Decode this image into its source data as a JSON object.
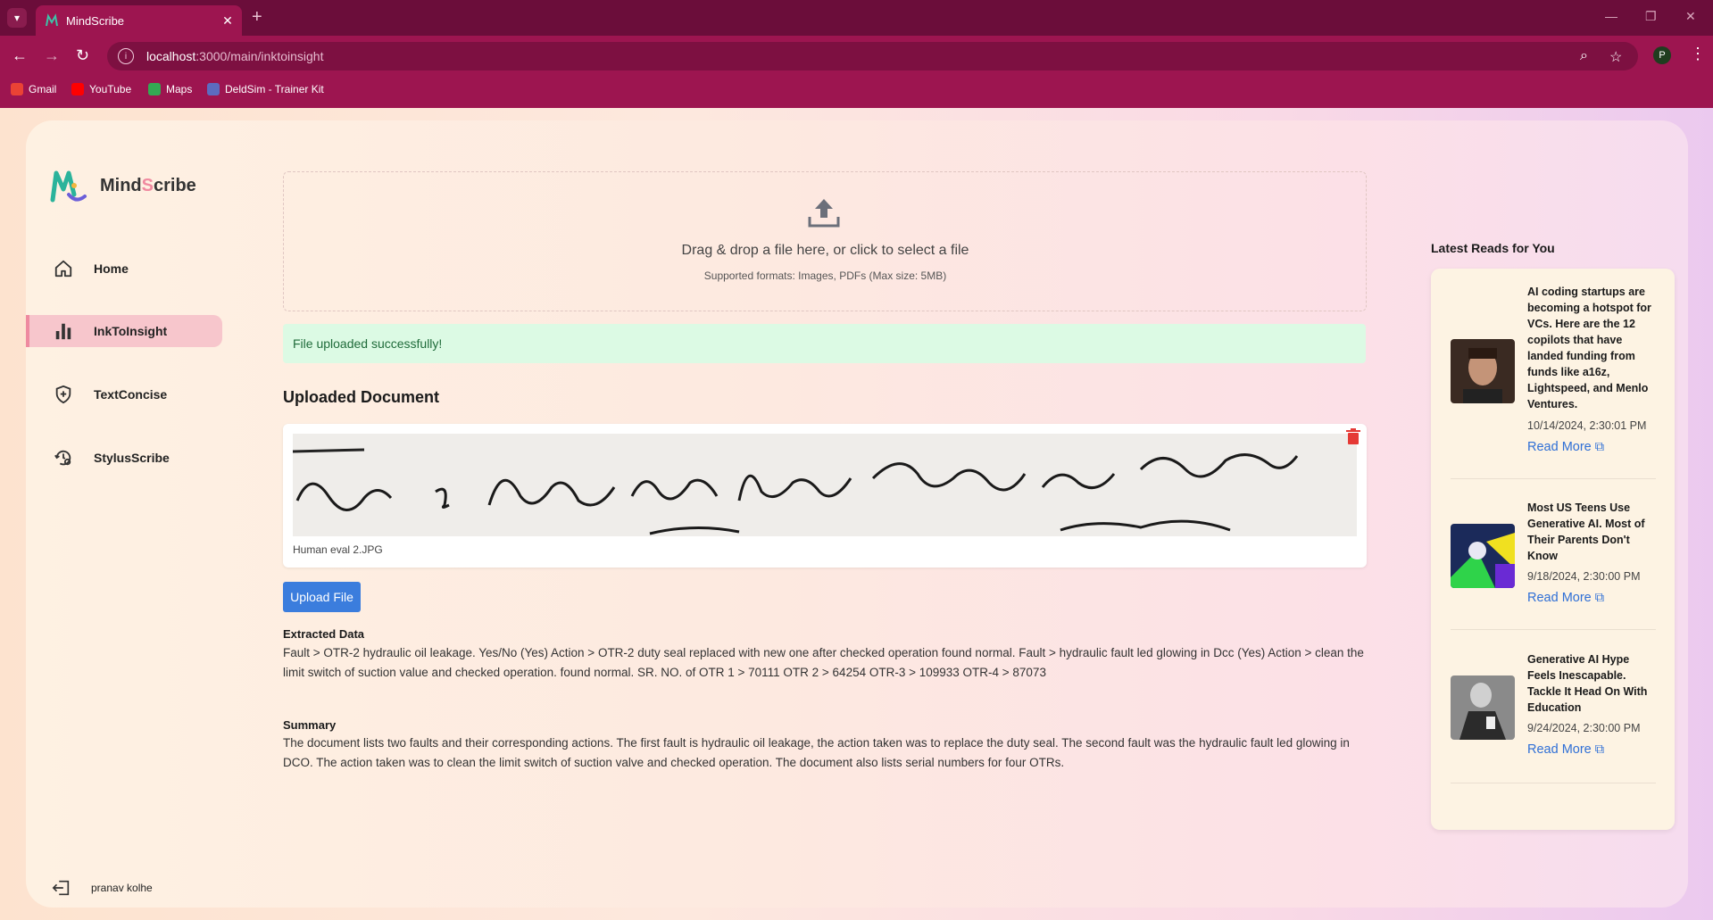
{
  "browser": {
    "tab_title": "MindScribe",
    "url_host": "localhost",
    "url_path": ":3000/main/inktoinsight",
    "profile_initial": "P",
    "bookmarks": [
      {
        "label": "Gmail",
        "color": "#ea4335"
      },
      {
        "label": "YouTube",
        "color": "#ff0000"
      },
      {
        "label": "Maps",
        "color": "#34a853"
      },
      {
        "label": "DeldSim - Trainer Kit",
        "color": "#5c6bc0"
      }
    ]
  },
  "brand": {
    "prefix": "Mind",
    "accent": "S",
    "suffix": "cribe"
  },
  "sidebar": {
    "items": [
      {
        "label": "Home",
        "icon": "home-icon"
      },
      {
        "label": "InkToInsight",
        "icon": "bar-chart-icon",
        "active": true
      },
      {
        "label": "TextConcise",
        "icon": "shield-plus-icon"
      },
      {
        "label": "StylusScribe",
        "icon": "settings-history-icon"
      }
    ],
    "user": "pranav kolhe"
  },
  "upload": {
    "drop_text": "Drag & drop a file here, or click to select a file",
    "supported": "Supported formats: Images, PDFs (Max size: 5MB)",
    "success_message": "File uploaded successfully!",
    "uploaded_heading": "Uploaded Document",
    "file_name": "Human eval 2.JPG",
    "button_label": "Upload File"
  },
  "extracted": {
    "heading": "Extracted Data",
    "text": "Fault > OTR-2 hydraulic oil leakage. Yes/No (Yes) Action > OTR-2 duty seal replaced with new one after checked operation found normal. Fault > hydraulic fault led glowing in Dcc (Yes) Action > clean the limit switch of suction value and checked operation. found normal. SR. NO. of OTR 1 > 70111 OTR 2 > 64254 OTR-3 > 109933 OTR-4 > 87073"
  },
  "summary": {
    "heading": "Summary",
    "text": "The document lists two faults and their corresponding actions. The first fault is hydraulic oil leakage, the action taken was to replace the duty seal. The second fault was the hydraulic fault led glowing in DCO. The action taken was to clean the limit switch of suction valve and checked operation. The document also lists serial numbers for four OTRs."
  },
  "reads": {
    "heading": "Latest Reads for You",
    "read_more": "Read More",
    "items": [
      {
        "title": "AI coding startups are becoming a hotspot for VCs. Here are the 12 copilots that have landed funding from funds like a16z, Lightspeed, and Menlo Ventures.",
        "date": "10/14/2024, 2:30:01 PM"
      },
      {
        "title": "Most US Teens Use Generative AI. Most of Their Parents Don't Know",
        "date": "9/18/2024, 2:30:00 PM"
      },
      {
        "title": "Generative AI Hype Feels Inescapable. Tackle It Head On With Education",
        "date": "9/24/2024, 2:30:00 PM"
      }
    ]
  },
  "colors": {
    "accent": "#9d1550",
    "link": "#2f6fd6",
    "button": "#3b7ddd",
    "success_bg": "#dcfae4"
  }
}
